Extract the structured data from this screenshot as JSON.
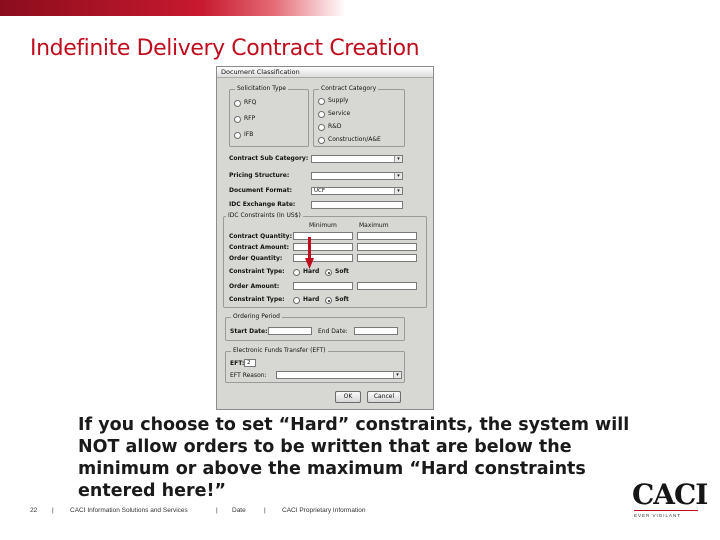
{
  "slide": {
    "title": "Indefinite Delivery Contract Creation",
    "caption": "If you choose to set “Hard” constraints, the system will NOT allow orders to be written that are below the minimum or above the maximum “Hard constraints entered here!”",
    "page_number": "22",
    "footer_company": "CACI Information Solutions and Services",
    "footer_date": "Date",
    "footer_proprietary": "CACI Proprietary Information",
    "footer_separator": "|",
    "logo_text": "CACI",
    "logo_tagline": "EVER VIGILANT",
    "brand_red": "#c00d1e"
  },
  "dialog": {
    "title": "Document Classification",
    "solicitation_type": {
      "label": "Solicitation Type",
      "options": [
        "RFQ",
        "RFP",
        "IFB"
      ],
      "selected": "none"
    },
    "contract_category": {
      "label": "Contract Category",
      "options": [
        "Supply",
        "Service",
        "R&D",
        "Construction/A&E"
      ],
      "selected": "none"
    },
    "contract_sub_category": {
      "label": "Contract Sub Category:",
      "value": ""
    },
    "pricing_structure": {
      "label": "Pricing Structure:",
      "value": ""
    },
    "document_format": {
      "label": "Document Format:",
      "value": "UCF"
    },
    "idc_exchange_rate": {
      "label": "IDC Exchange Rate:",
      "value": ""
    },
    "idc_constraints": {
      "label": "IDC Constraints (In US$)",
      "col_min": "Minimum",
      "col_max": "Maximum",
      "contract_quantity": "Contract Quantity:",
      "contract_amount": "Contract Amount:",
      "order_quantity": "Order Quantity:",
      "constraint_type_1": "Constraint Type:",
      "order_amount": "Order Amount:",
      "constraint_type_2": "Constraint Type:",
      "hard": "Hard",
      "soft": "Soft",
      "selected": "Soft"
    },
    "ordering_period": {
      "label": "Ordering Period",
      "start_date": "Start Date:",
      "end_date": "End Date:"
    },
    "eft": {
      "label": "Electronic Funds Transfer (EFT)",
      "eft_label": "EFT:",
      "eft_value": "2",
      "reason_label": "EFT Reason:"
    },
    "ok_label": "OK",
    "cancel_label": "Cancel",
    "dropdown_icon": "chevron-down-icon"
  },
  "colors": {
    "arrow": "#c00d1e",
    "dialog_bg": "#d7d7d3"
  }
}
